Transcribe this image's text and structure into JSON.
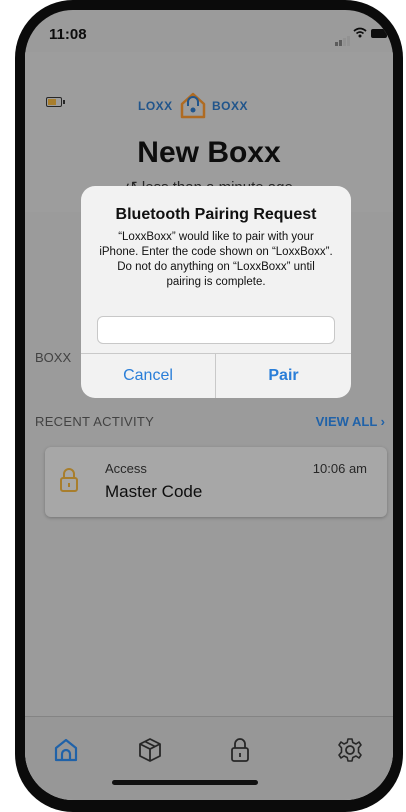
{
  "status_bar": {
    "time": "11:08"
  },
  "app": {
    "logo_left": "LOXX",
    "logo_right": "BOXX",
    "title": "New Boxx",
    "subtitle": "↺ less than a minute ago"
  },
  "sections": {
    "boxx_label": "BOXX",
    "recent_activity_label": "RECENT ACTIVITY",
    "view_all": "VIEW ALL ›"
  },
  "activity": {
    "type": "Access",
    "time": "10:06 am",
    "name": "Master Code"
  },
  "dialog": {
    "title": "Bluetooth Pairing Request",
    "message": "“LoxxBoxx” would like to pair with your iPhone. Enter the code shown on “LoxxBoxx”. Do not do anything on “LoxxBoxx” until pairing is complete.",
    "input_value": "",
    "cancel_label": "Cancel",
    "pair_label": "Pair"
  },
  "tabs": [
    {
      "icon": "home-icon",
      "active": true
    },
    {
      "icon": "box-icon",
      "active": false
    },
    {
      "icon": "lock-icon",
      "active": false
    },
    {
      "icon": "gear-icon",
      "active": false
    }
  ],
  "colors": {
    "accent": "#2a7ed8",
    "logo_blue": "#2b6db3",
    "logo_orange": "#e08a2c",
    "lock_orange": "#d8a23a"
  }
}
